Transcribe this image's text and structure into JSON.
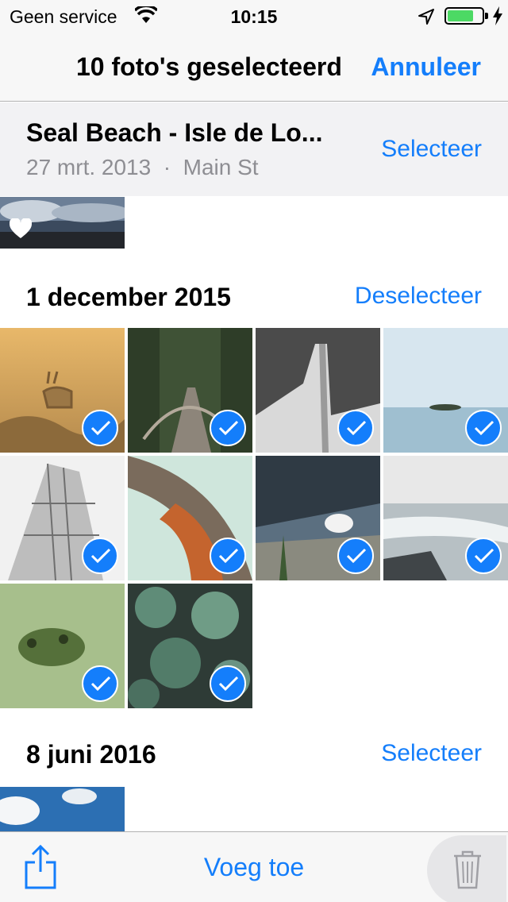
{
  "status_bar": {
    "carrier": "Geen service",
    "time": "10:15",
    "icons": [
      "wifi-icon",
      "location-icon",
      "battery-icon",
      "charging-icon"
    ]
  },
  "navbar": {
    "title": "10 foto's geselecteerd",
    "cancel_label": "Annuleer"
  },
  "moments": [
    {
      "title": "Seal Beach - Isle de Lo...",
      "date": "27 mrt. 2013",
      "separator": "·",
      "location": "Main St",
      "action": "Selecteer",
      "photos": [
        {
          "desc": "landscape-clouds",
          "favorite": true,
          "selected": false
        }
      ]
    },
    {
      "title": "1 december 2015",
      "action": "Deselecteer",
      "photos": [
        {
          "desc": "deer-fog",
          "selected": true
        },
        {
          "desc": "forest-bridge",
          "selected": true
        },
        {
          "desc": "concrete-architecture",
          "selected": true
        },
        {
          "desc": "sea-island",
          "selected": true
        },
        {
          "desc": "flatiron-building",
          "selected": true
        },
        {
          "desc": "curved-building",
          "selected": true
        },
        {
          "desc": "mountain-goat",
          "selected": true
        },
        {
          "desc": "waterfall",
          "selected": true
        },
        {
          "desc": "frog-in-duckweed",
          "selected": true
        },
        {
          "desc": "succulents",
          "selected": true
        }
      ]
    },
    {
      "title": "8 juni 2016",
      "action": "Selecteer",
      "photos": [
        {
          "desc": "blue-sky-clouds",
          "selected": false
        }
      ]
    }
  ],
  "toolbar": {
    "share_icon": "share-icon",
    "add_label": "Voeg toe",
    "trash_icon": "trash-icon"
  },
  "colors": {
    "accent": "#147efb",
    "battery": "#4cd964"
  }
}
